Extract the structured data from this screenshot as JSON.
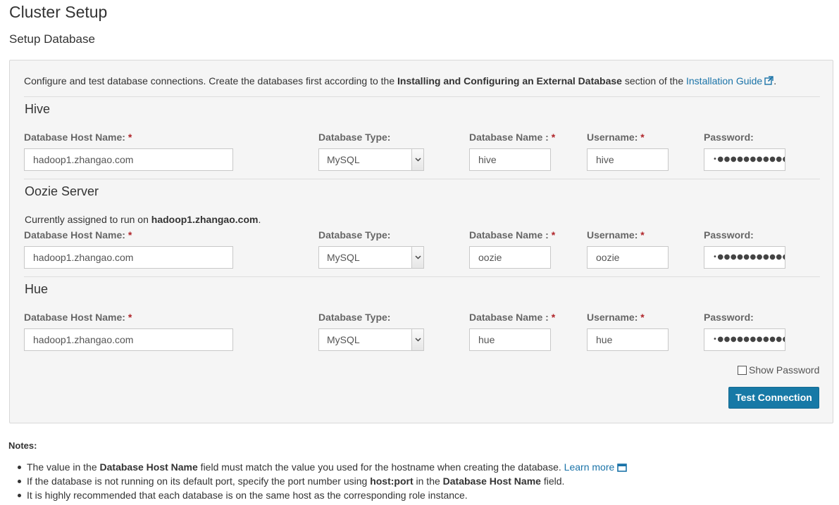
{
  "page": {
    "title": "Cluster Setup",
    "subtitle": "Setup Database"
  },
  "intro": {
    "text_before": "Configure and test database connections. Create the databases first according to the ",
    "bold_text": "Installing and Configuring an External Database",
    "text_middle": " section of the ",
    "link_text": "Installation Guide",
    "text_after": "."
  },
  "labels": {
    "host": "Database Host Name:",
    "type": "Database Type:",
    "name": "Database Name :",
    "user": "Username:",
    "password": "Password:",
    "required_mark": "*"
  },
  "sections": [
    {
      "title": "Hive",
      "host": "hadoop1.zhangao.com",
      "db_type": "MySQL",
      "db_name": "hive",
      "username": "hive",
      "password_mask": "•●●●●●●●●●●●"
    },
    {
      "title": "Oozie Server",
      "assigned_prefix": "Currently assigned to run on ",
      "assigned_host": "hadoop1.zhangao.com",
      "assigned_suffix": ".",
      "host": "hadoop1.zhangao.com",
      "db_type": "MySQL",
      "db_name": "oozie",
      "username": "oozie",
      "password_mask": "•●●●●●●●●●●●"
    },
    {
      "title": "Hue",
      "host": "hadoop1.zhangao.com",
      "db_type": "MySQL",
      "db_name": "hue",
      "username": "hue",
      "password_mask": "•●●●●●●●●●●●"
    }
  ],
  "show_password_label": "Show Password",
  "test_connection_label": "Test Connection",
  "notes": {
    "title": "Notes:",
    "items": [
      {
        "before": "The value in the ",
        "bold": "Database Host Name",
        "after": " field must match the value you used for the hostname when creating the database. ",
        "link": "Learn more"
      },
      {
        "before": "If the database is not running on its default port, specify the port number using ",
        "bold": "host:port",
        "middle": " in the ",
        "bold2": "Database Host Name",
        "after": " field."
      },
      {
        "text": "It is highly recommended that each database is on the same host as the corresponding role instance."
      }
    ]
  },
  "colors": {
    "accent": "#1779a6",
    "link": "#1a73a8",
    "required": "#b0252a",
    "panel_bg": "#f5f5f5"
  },
  "icons": {
    "external_link": "external-link-icon",
    "new_window": "new-window-icon",
    "select_caret": "chevron-down-icon"
  }
}
